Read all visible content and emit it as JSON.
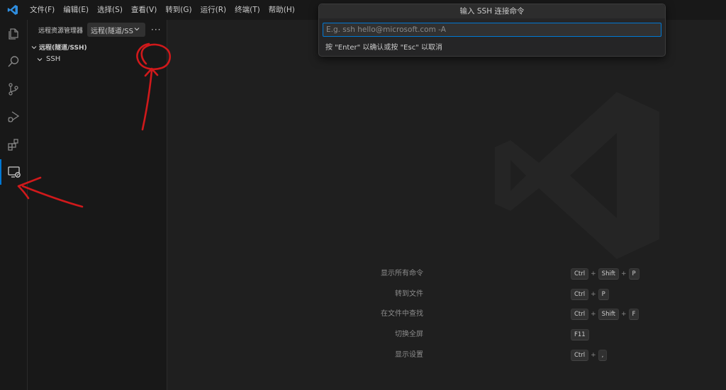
{
  "menu": [
    "文件(F)",
    "编辑(E)",
    "选择(S)",
    "查看(V)",
    "转到(G)",
    "运行(R)",
    "终端(T)",
    "帮助(H)"
  ],
  "activity_bar": [
    "explorer-icon",
    "search-icon",
    "source-control-icon",
    "run-debug-icon",
    "extensions-icon",
    "remote-explorer-icon"
  ],
  "sidebar": {
    "title": "远程资源管理器",
    "select_value": "远程(隧道/SSH)",
    "more": "···",
    "section_title": "远程(隧道/SSH)",
    "ssh_item": "SSH"
  },
  "quick_input": {
    "title": "输入 SSH 连接命令",
    "placeholder": "E.g. ssh hello@microsoft.com -A",
    "value": "",
    "hint": "按 \"Enter\" 以确认或按 \"Esc\" 以取消"
  },
  "shortcuts": [
    {
      "label": "显示所有命令",
      "keys": [
        "Ctrl",
        "Shift",
        "P"
      ]
    },
    {
      "label": "转到文件",
      "keys": [
        "Ctrl",
        "P"
      ]
    },
    {
      "label": "在文件中查找",
      "keys": [
        "Ctrl",
        "Shift",
        "F"
      ]
    },
    {
      "label": "切换全屏",
      "keys": [
        "F11"
      ]
    },
    {
      "label": "显示设置",
      "keys": [
        "Ctrl",
        ","
      ]
    }
  ],
  "colors": {
    "accent": "#0078d4",
    "annotation": "#d0191b",
    "background": "#1f1f1f"
  }
}
